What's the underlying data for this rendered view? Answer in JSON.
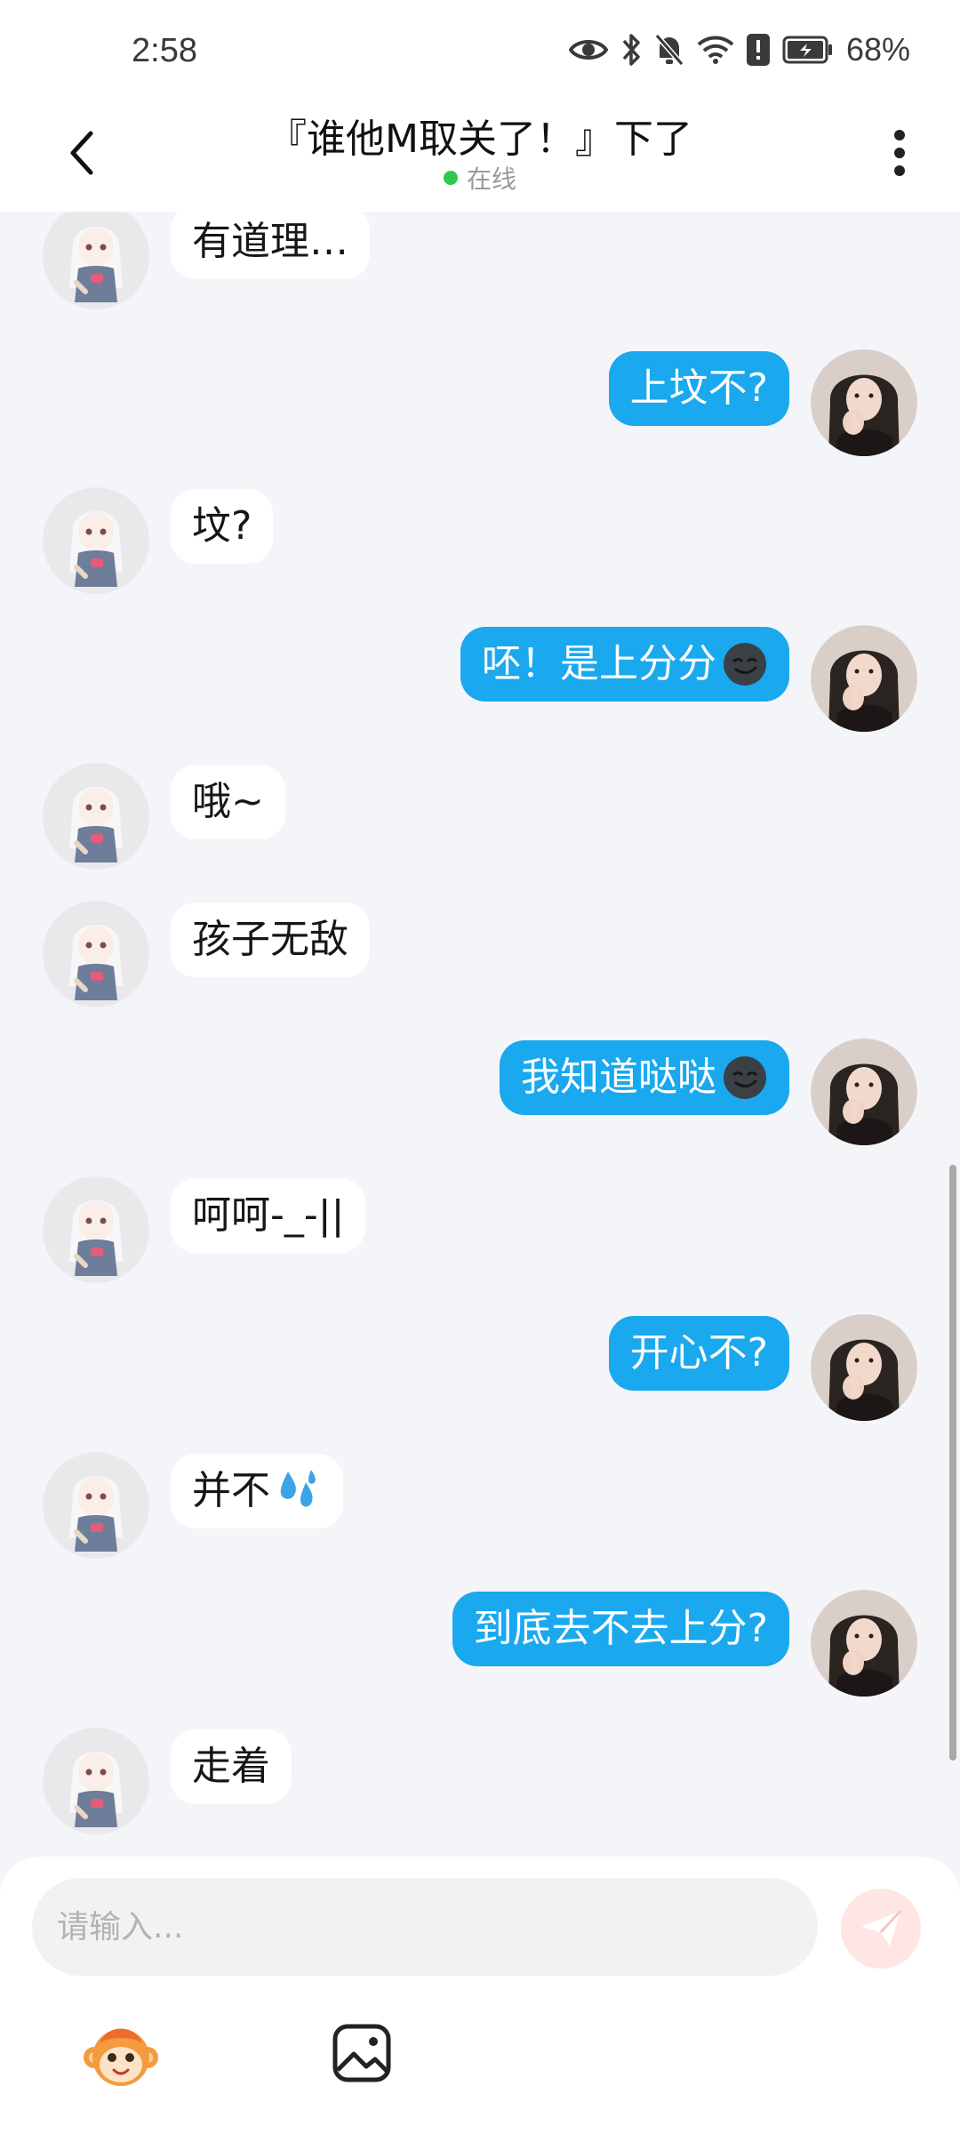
{
  "status_bar": {
    "time": "2:58",
    "battery": "68%",
    "icons": [
      "eye-icon",
      "bluetooth-icon",
      "bell-off-icon",
      "wifi-icon",
      "alert-icon",
      "battery-icon"
    ]
  },
  "header": {
    "title": "『谁他M取关了！』下了",
    "status": "在线",
    "back_icon": "chevron-left-icon",
    "more_icon": "more-vertical-icon"
  },
  "messages": [
    {
      "side": "left",
      "text": "有道理…",
      "emoji": ""
    },
    {
      "side": "right",
      "text": "上坟不?",
      "emoji": ""
    },
    {
      "side": "left",
      "text": "坟?",
      "emoji": ""
    },
    {
      "side": "right",
      "text": "呸！是上分分",
      "emoji": "smirk-face"
    },
    {
      "side": "left",
      "text": "哦~",
      "emoji": ""
    },
    {
      "side": "left",
      "text": "孩子无敌",
      "emoji": ""
    },
    {
      "side": "right",
      "text": "我知道哒哒",
      "emoji": "smirk-face"
    },
    {
      "side": "left",
      "text": "呵呵-_-||",
      "emoji": ""
    },
    {
      "side": "right",
      "text": "开心不?",
      "emoji": ""
    },
    {
      "side": "left",
      "text": "并不",
      "emoji": "sweat-drops"
    },
    {
      "side": "right",
      "text": "到底去不去上分?",
      "emoji": ""
    },
    {
      "side": "left",
      "text": "走着",
      "emoji": ""
    }
  ],
  "input": {
    "placeholder": "请输入...",
    "value": ""
  },
  "toolbar": {
    "emoji_icon": "monkey-sticker-icon",
    "image_icon": "image-icon",
    "send_icon": "send-icon"
  },
  "colors": {
    "outgoing_bubble": "#1aa8ee",
    "incoming_bubble": "#ffffff",
    "background": "#f4f5f8",
    "online": "#2fc84f"
  }
}
